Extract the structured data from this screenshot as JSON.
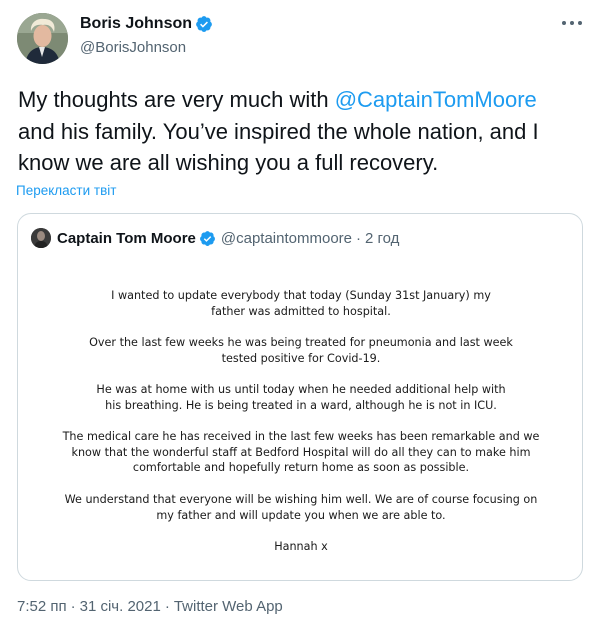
{
  "tweet": {
    "author_name": "Boris Johnson",
    "author_handle": "@BorisJohnson",
    "text_before": "My thoughts are very much with ",
    "mention": "@CaptainTomMoore",
    "text_after": " and his family. You’ve inspired the whole nation, and I know we are all wishing you a full recovery.",
    "translate_label": "Перекласти твіт",
    "time": "7:52 пп",
    "date": "31 січ. 2021",
    "source": "Twitter Web App",
    "separator": "·"
  },
  "quote": {
    "name": "Captain Tom Moore",
    "handle": "@captaintommoore",
    "separator": "·",
    "age": "2 год",
    "letter": [
      "I wanted to update everybody that today (Sunday 31st January) my father was admitted to hospital.",
      "Over the last few weeks he was being treated for pneumonia and last week tested positive for Covid-19.",
      "He was at home with us until today when he needed additional help with his breathing. He is being treated in a ward, although he is not in ICU.",
      "The medical care he has received in the last few weeks has been remarkable and we know that the wonderful staff at Bedford Hospital will do all they can to make him comfortable and hopefully return home as soon as possible.",
      "We understand that everyone will be wishing him well. We are of course focusing on my father and will update you when we are able to.",
      "Hannah x"
    ]
  },
  "colors": {
    "link": "#1d9bf0",
    "verified": "#1d9bf0",
    "secondary_text": "#536471",
    "border": "#cfd9de"
  },
  "icons": [
    "verified-badge-icon",
    "more-options-icon"
  ]
}
